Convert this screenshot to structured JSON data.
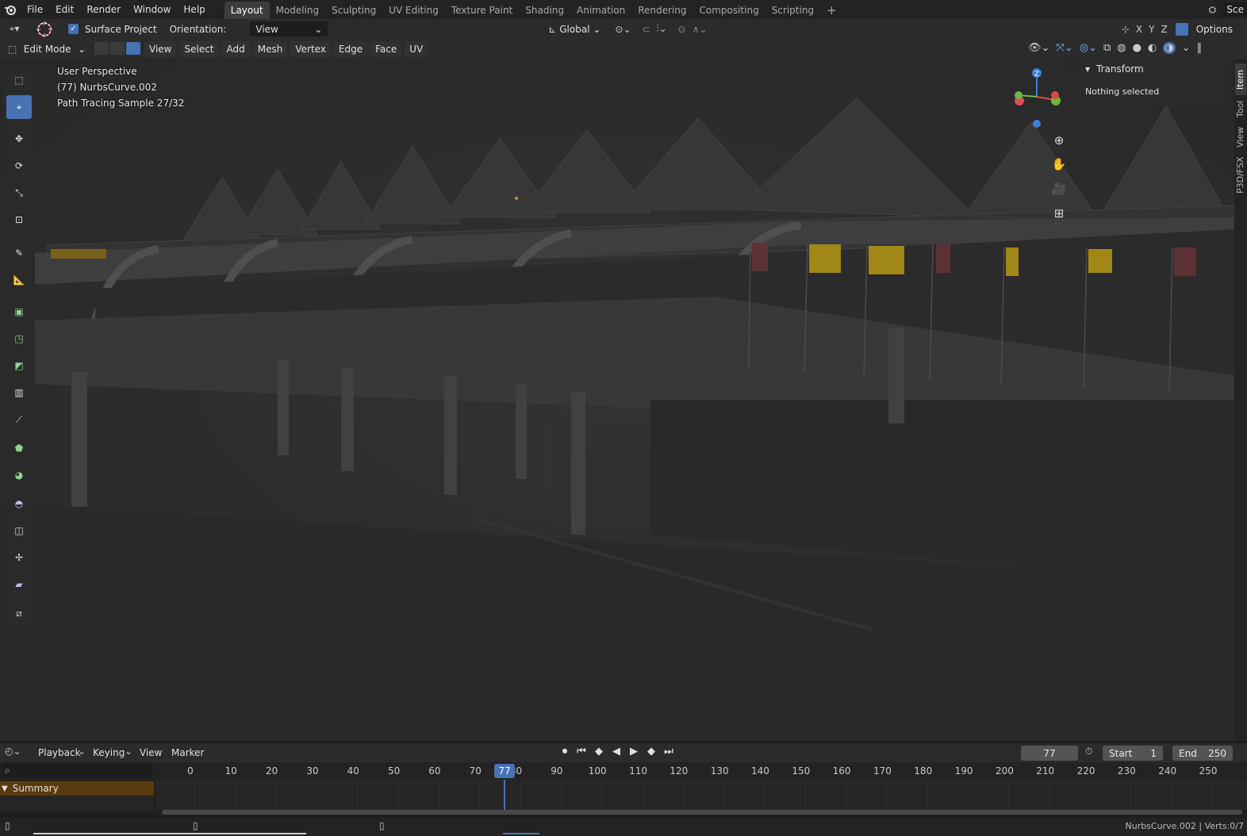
{
  "menu": {
    "items": [
      "File",
      "Edit",
      "Render",
      "Window",
      "Help"
    ],
    "workspaces": [
      "Layout",
      "Modeling",
      "Sculpting",
      "UV Editing",
      "Texture Paint",
      "Shading",
      "Animation",
      "Rendering",
      "Compositing",
      "Scripting"
    ],
    "active_workspace": "Layout",
    "add_tab": "+",
    "scene_label": "Sce"
  },
  "tool_header": {
    "surface_project_label": "Surface Project",
    "orientation_label": "Orientation:",
    "orientation_value": "View",
    "transform_orientation": "Global",
    "axis_x": "X",
    "axis_y": "Y",
    "axis_z": "Z",
    "options_label": "Options"
  },
  "editor_header": {
    "mode": "Edit Mode",
    "menus": [
      "View",
      "Select",
      "Add",
      "Mesh",
      "Vertex",
      "Edge",
      "Face",
      "UV"
    ]
  },
  "viewport": {
    "info_line1": "User Perspective",
    "info_line2": "(77) NurbsCurve.002",
    "info_line3": "Path Tracing Sample 27/32",
    "gizmo_z": "Z",
    "gizmo_y": "Y",
    "gizmo_x": "X"
  },
  "npanel": {
    "section_title": "Transform",
    "empty_msg": "Nothing selected",
    "tabs": [
      "Item",
      "Tool",
      "View",
      "P3D/FSX"
    ]
  },
  "timeline": {
    "menus": [
      "Playback",
      "Keying",
      "View",
      "Marker"
    ],
    "current_frame": "77",
    "start_label": "Start",
    "start_value": "1",
    "end_label": "End",
    "end_value": "250",
    "ruler_ticks": [
      0,
      10,
      20,
      30,
      40,
      50,
      60,
      70,
      80,
      90,
      100,
      110,
      120,
      130,
      140,
      150,
      160,
      170,
      180,
      190,
      200,
      210,
      220,
      230,
      240,
      250
    ],
    "summary_label": "Summary"
  },
  "statusbar": {
    "info": "NurbsCurve.002 | Verts:0/7"
  },
  "colors": {
    "accent": "#4772b3",
    "frame_marker": "#4772b3",
    "summary_bg": "#5a3a10"
  }
}
